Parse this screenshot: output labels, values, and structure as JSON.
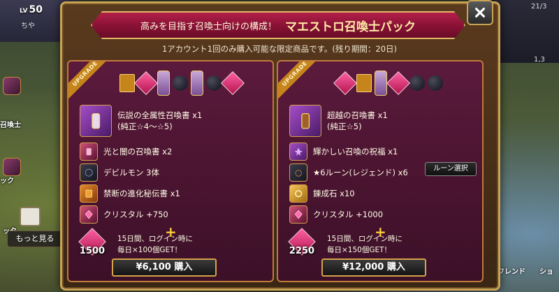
{
  "background": {
    "level_label": "LV",
    "level_value": "50",
    "player_name": "ちや",
    "side_labels": [
      "召喚士",
      "ック",
      "ッタ"
    ],
    "right_values": [
      "21/3",
      "1,3"
    ],
    "more_button": "もっと見る",
    "friend_button": "フレンド",
    "shop_button": "ショ"
  },
  "modal": {
    "title_sub": "高みを目指す召喚士向けの構成！",
    "title_main": "マエストロ召喚士パック",
    "limit_text": "1アカウント1回のみ購入可能な限定商品です。(残り期間：20日)",
    "close_icon": "close-icon"
  },
  "packs": [
    {
      "ribbon": "UPGRADE",
      "items": [
        {
          "icon": "legendary-scroll-icon",
          "line1": "伝説の全属性召喚書 x1",
          "line2": "(純正☆4〜☆5)"
        },
        {
          "icon": "light-dark-scroll-icon",
          "line1": "光と闇の召喚書 x2",
          "line2": ""
        },
        {
          "icon": "devilmon-icon",
          "line1": "デビルモン 3体",
          "line2": ""
        },
        {
          "icon": "forbidden-book-icon",
          "line1": "禁断の進化秘伝書 x1",
          "line2": ""
        },
        {
          "icon": "crystal-icon",
          "line1": "クリスタル +750",
          "line2": ""
        }
      ],
      "bonus_amount": "1500",
      "bonus_line1": "15日間、ログイン時に",
      "bonus_line2": "毎日×100個GET！",
      "buy_label": "¥6,100 購入"
    },
    {
      "ribbon": "UPGRADE",
      "items": [
        {
          "icon": "transcendence-scroll-icon",
          "line1": "超越の召喚書 x1",
          "line2": "(純正☆5)"
        },
        {
          "icon": "blessing-icon",
          "line1": "輝かしい召喚の祝福 x1",
          "line2": ""
        },
        {
          "icon": "rune-icon",
          "line1": "★6ルーン(レジェンド) x6",
          "line2": ""
        },
        {
          "icon": "alchemy-stone-icon",
          "line1": "錬成石 x10",
          "line2": ""
        },
        {
          "icon": "crystal-icon",
          "line1": "クリスタル +1000",
          "line2": ""
        }
      ],
      "rune_select": "ルーン選択",
      "bonus_amount": "2250",
      "bonus_line1": "15日間、ログイン時に",
      "bonus_line2": "毎日×150個GET！",
      "buy_label": "¥12,000 購入"
    }
  ]
}
